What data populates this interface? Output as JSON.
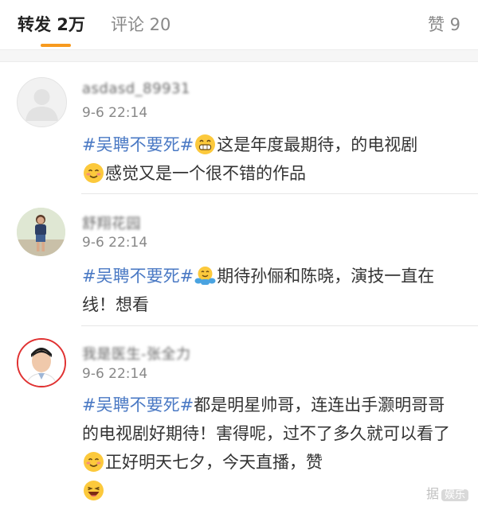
{
  "tabs": {
    "repost": "转发 2万",
    "comment": "评论 20",
    "like": "赞 9"
  },
  "accent_color": "#f79a1f",
  "topic_color": "#4a79c4",
  "comments": [
    {
      "user": "asdasd_89931",
      "time": "9-6 22:14",
      "topic": "#吴聘不要死#",
      "emoji1": "grin-emoji",
      "text1": "这是年度最期待，的电视剧",
      "emoji2": "smile-emoji",
      "text2": "感觉又是一个很不错的作品"
    },
    {
      "user": "舒翔花园",
      "time": "9-6 22:14",
      "topic": "#吴聘不要死#",
      "emoji1": "hug-emoji",
      "text1": "期待孙俪和陈晓，演技一直在线！想看"
    },
    {
      "user": "我是医生-张全力",
      "time": "9-6 22:14",
      "topic": "#吴聘不要死#",
      "text1": "都是明星帅哥，连连出手灏明哥哥的电视剧好期待！害得呢，过不了多久就可以看了",
      "emoji1": "smile-emoji",
      "text2": "正好明天七夕，今天直播，赞",
      "emoji2": "laugh-emoji"
    }
  ],
  "watermark": {
    "text": "据",
    "box": "娱乐"
  }
}
